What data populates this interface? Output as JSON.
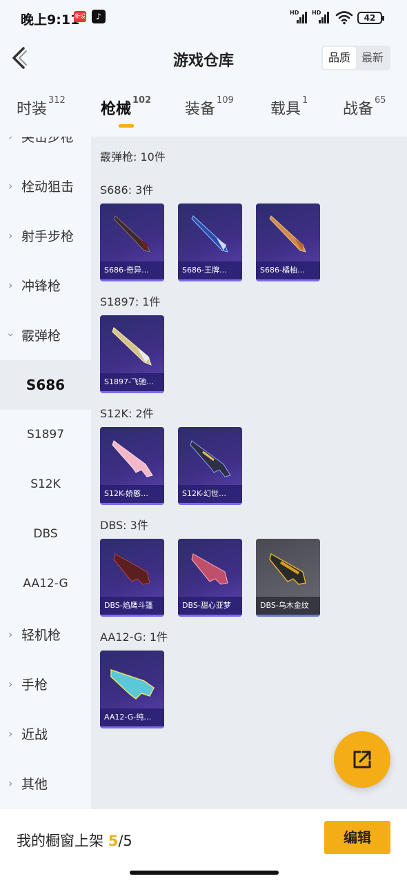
{
  "status_bar": {
    "time": "晚上9:11",
    "notification": "新设",
    "battery": "42",
    "signal_1": "HD",
    "signal_2": "HD"
  },
  "header": {
    "title": "游戏仓库",
    "sort_options": [
      "品质",
      "最新"
    ],
    "active_sort": "品质"
  },
  "tabs": [
    {
      "label": "时装",
      "count": "312"
    },
    {
      "label": "枪械",
      "count": "102"
    },
    {
      "label": "装备",
      "count": "109"
    },
    {
      "label": "载具",
      "count": "1"
    },
    {
      "label": "战备",
      "count": "65"
    }
  ],
  "active_tab": "枪械",
  "sidebar": {
    "categories": [
      "突击步枪",
      "栓动狙击",
      "射手步枪",
      "冲锋枪",
      "霰弹枪",
      "轻机枪",
      "手枪",
      "近战",
      "其他"
    ],
    "expanded": "霰弹枪",
    "sub_items": [
      "S686",
      "S1897",
      "S12K",
      "DBS",
      "AA12-G"
    ],
    "active_sub": "S686"
  },
  "content": {
    "category_total": "霰弹枪: 10件",
    "sections": [
      {
        "title": "S686: 3件",
        "items": [
          {
            "name": "S686-奇异…",
            "icon": "double-barrel-shotgun-dark"
          },
          {
            "name": "S686-王牌…",
            "icon": "double-barrel-shotgun-blue"
          },
          {
            "name": "S686-橘柚…",
            "icon": "double-barrel-shotgun-orange"
          }
        ]
      },
      {
        "title": "S1897: 1件",
        "items": [
          {
            "name": "S1897-飞驰…",
            "icon": "pump-shotgun-gold"
          }
        ]
      },
      {
        "title": "S12K: 2件",
        "items": [
          {
            "name": "S12K-娇憨…",
            "icon": "rifle-shotgun-pink"
          },
          {
            "name": "S12K-幻世…",
            "icon": "rifle-shotgun-purple"
          }
        ]
      },
      {
        "title": "DBS: 3件",
        "items": [
          {
            "name": "DBS-焰鹰斗篷",
            "icon": "bullpup-shotgun-red"
          },
          {
            "name": "DBS-甜心亚梦",
            "icon": "bullpup-shotgun-pink"
          },
          {
            "name": "DBS-乌木金纹",
            "icon": "bullpup-shotgun-gold"
          }
        ]
      },
      {
        "title": "AA12-G: 1件",
        "items": [
          {
            "name": "AA12-G-纯…",
            "icon": "auto-shotgun-cyan"
          }
        ]
      }
    ]
  },
  "bottom_bar": {
    "label": "我的橱窗上架",
    "current": "5",
    "total": "/5",
    "edit_label": "编辑"
  },
  "colors": {
    "accent": "#f5ad17",
    "card_purple": "#3f2f86",
    "card_gray": "#5b5b63"
  }
}
